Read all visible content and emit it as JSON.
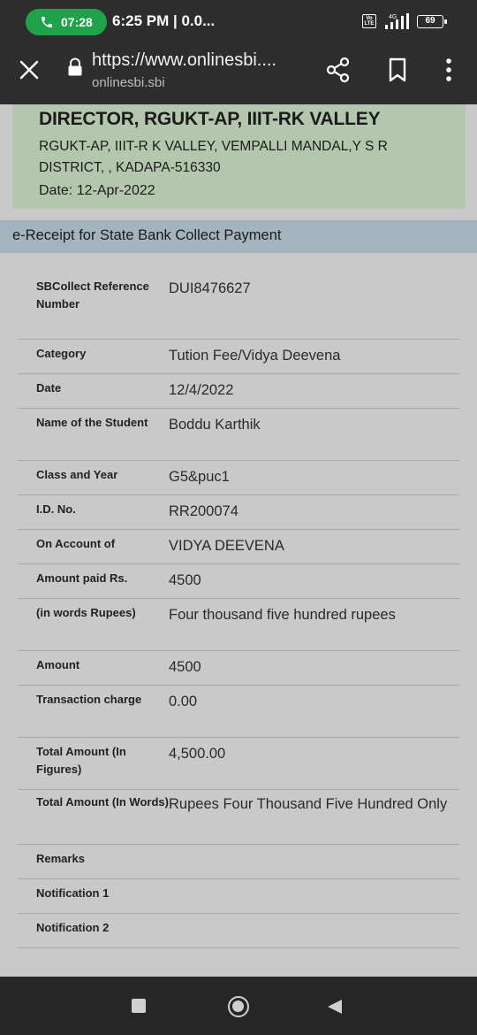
{
  "status_bar": {
    "call_time": "07:28",
    "text": "6:25 PM | 0.0...",
    "volte": "Vo LTE",
    "network": "4G",
    "battery": "69"
  },
  "browser": {
    "url": "https://www.onlinesbi....",
    "domain": "onlinesbi.sbi"
  },
  "header": {
    "title": "DIRECTOR, RGUKT-AP, IIIT-RK VALLEY",
    "address": "RGUKT-AP, IIIT-R K VALLEY, VEMPALLI MANDAL,Y S R DISTRICT, , KADAPA-516330",
    "date": "Date: 12-Apr-2022"
  },
  "receipt_title": "e-Receipt for State Bank Collect Payment",
  "rows": [
    {
      "label": "SBCollect Reference Number",
      "value": "DUI8476627"
    },
    {
      "label": "Category",
      "value": "Tution Fee/Vidya Deevena"
    },
    {
      "label": "Date",
      "value": "12/4/2022"
    },
    {
      "label": "Name of the Student",
      "value": "Boddu Karthik"
    },
    {
      "label": "Class and Year",
      "value": "G5&puc1"
    },
    {
      "label": "I.D. No.",
      "value": "RR200074"
    },
    {
      "label": "On Account of",
      "value": "VIDYA DEEVENA"
    },
    {
      "label": "Amount paid Rs.",
      "value": "4500"
    },
    {
      "label": "(in words Rupees)",
      "value": "Four thousand five hundred rupees"
    },
    {
      "label": "Amount",
      "value": "4500"
    },
    {
      "label": "Transaction charge",
      "value": "0.00"
    },
    {
      "label": "Total Amount (In Figures)",
      "value": "4,500.00"
    },
    {
      "label": "Total Amount (In Words)",
      "value": "Rupees Four Thousand Five Hundred Only"
    },
    {
      "label": "Remarks",
      "value": ""
    },
    {
      "label": "Notification 1",
      "value": ""
    },
    {
      "label": "Notification 2",
      "value": ""
    }
  ]
}
